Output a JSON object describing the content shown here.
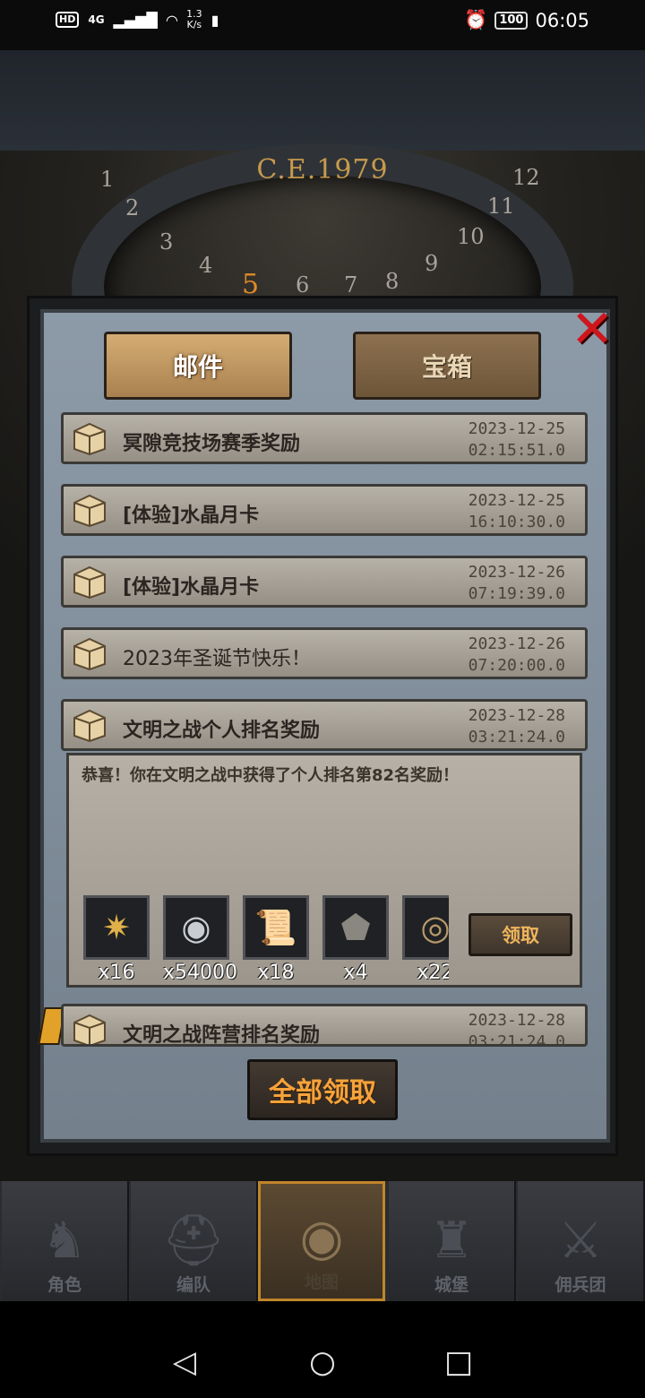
{
  "status_bar": {
    "hd": "HD",
    "network": "4G",
    "speed_value": "1.3",
    "speed_unit": "K/s",
    "battery": "100",
    "time": "06:05"
  },
  "background": {
    "year": "C.E.1979",
    "clock_numbers": [
      "1",
      "2",
      "3",
      "4",
      "5",
      "6",
      "7",
      "8",
      "9",
      "10",
      "11",
      "12"
    ]
  },
  "dialog": {
    "tabs": [
      {
        "label": "邮件",
        "active": true
      },
      {
        "label": "宝箱",
        "active": false
      }
    ],
    "close_icon": "close-x-icon",
    "mails": [
      {
        "title": "冥隙竞技场赛季奖励",
        "date": "2023-12-25",
        "time": "02:15:51.0"
      },
      {
        "title": "[体验]水晶月卡",
        "date": "2023-12-25",
        "time": "16:10:30.0"
      },
      {
        "title": "[体验]水晶月卡",
        "date": "2023-12-26",
        "time": "07:19:39.0"
      },
      {
        "title": "2023年圣诞节快乐！",
        "date": "2023-12-26",
        "time": "07:20:00.0"
      },
      {
        "title": "文明之战个人排名奖励",
        "date": "2023-12-28",
        "time": "03:21:24.0"
      },
      {
        "title": "文明之战阵营排名奖励",
        "date": "2023-12-28",
        "time": "03:21:24.0"
      }
    ],
    "expanded": {
      "body": "恭喜！你在文明之战中获得了个人排名第82名奖励！",
      "rewards": [
        {
          "icon": "compass-star-icon",
          "qty": "x16"
        },
        {
          "icon": "silver-coin-icon",
          "qty": "x54000"
        },
        {
          "icon": "scroll-icon",
          "qty": "x18"
        },
        {
          "icon": "ore-stone-icon",
          "qty": "x4"
        },
        {
          "icon": "wood-log-icon",
          "qty": "x22"
        }
      ],
      "claim_label": "领取"
    },
    "claim_all_label": "全部领取"
  },
  "bottom_nav": [
    {
      "label": "角色",
      "icon": "knight-icon",
      "active": false
    },
    {
      "label": "编队",
      "icon": "helmet-icon",
      "active": false
    },
    {
      "label": "地图",
      "icon": "globe-map-icon",
      "active": true
    },
    {
      "label": "城堡",
      "icon": "castle-icon",
      "active": false
    },
    {
      "label": "佣兵团",
      "icon": "mercenary-icon",
      "active": false
    }
  ],
  "system_nav": {
    "back_icon": "back-triangle-icon",
    "home_icon": "home-circle-icon",
    "recents_icon": "recents-square-icon"
  }
}
